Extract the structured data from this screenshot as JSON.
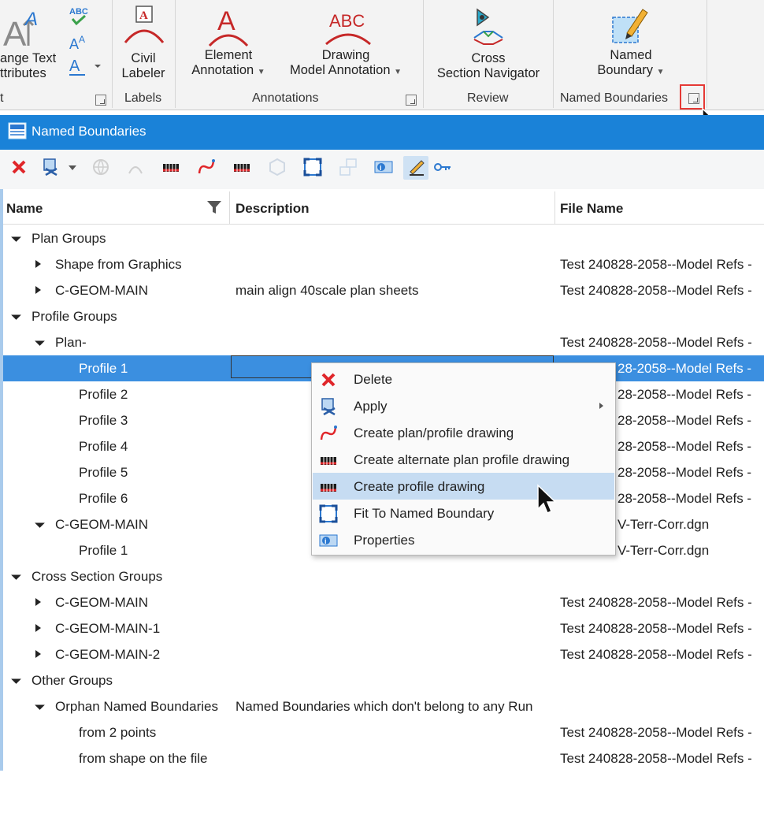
{
  "ribbon": {
    "text_group": {
      "button_label_line1": "ange Text",
      "button_label_line2": "ttributes",
      "group_label": "t"
    },
    "labels_group": {
      "button_label_line1": "Civil",
      "button_label_line2": "Labeler",
      "group_label": "Labels"
    },
    "annotations_group": {
      "element_line1": "Element",
      "element_line2": "Annotation",
      "drawing_line1": "Drawing",
      "drawing_line2": "Model Annotation",
      "group_label": "Annotations"
    },
    "review_group": {
      "button_label_line1": "Cross",
      "button_label_line2": "Section Navigator",
      "group_label": "Review"
    },
    "named_boundaries_group": {
      "button_label_line1": "Named",
      "button_label_line2": "Boundary",
      "group_label": "Named Boundaries"
    },
    "icon_texts": {
      "abc_small": "ABC",
      "abc_large": "ABC",
      "letter_a": "A"
    }
  },
  "window": {
    "title": "Named Boundaries"
  },
  "grid": {
    "columns": {
      "name": "Name",
      "description": "Description",
      "file_name": "File Name"
    },
    "rows": [
      {
        "name": "Plan Groups",
        "description": "",
        "file": ""
      },
      {
        "name": "Shape from Graphics",
        "description": "",
        "file": "Test 240828-2058--Model Refs -"
      },
      {
        "name": "C-GEOM-MAIN",
        "description": "main align 40scale plan sheets",
        "file": "Test 240828-2058--Model Refs -"
      },
      {
        "name": "Profile Groups",
        "description": "",
        "file": ""
      },
      {
        "name": "Plan-",
        "description": "",
        "file": "Test 240828-2058--Model Refs -"
      },
      {
        "name": "Profile 1",
        "description": "",
        "file": "28-2058--Model Refs -"
      },
      {
        "name": "Profile 2",
        "description": "",
        "file": "28-2058--Model Refs -"
      },
      {
        "name": "Profile 3",
        "description": "",
        "file": "28-2058--Model Refs -"
      },
      {
        "name": "Profile 4",
        "description": "",
        "file": "28-2058--Model Refs -"
      },
      {
        "name": "Profile 5",
        "description": "",
        "file": "28-2058--Model Refs -"
      },
      {
        "name": "Profile 6",
        "description": "",
        "file": "28-2058--Model Refs -"
      },
      {
        "name": "C-GEOM-MAIN",
        "description": "",
        "file": "V-Terr-Corr.dgn"
      },
      {
        "name": "Profile 1",
        "description": "",
        "file": "V-Terr-Corr.dgn"
      },
      {
        "name": "Cross Section Groups",
        "description": "",
        "file": ""
      },
      {
        "name": "C-GEOM-MAIN",
        "description": "",
        "file": "Test 240828-2058--Model Refs -"
      },
      {
        "name": "C-GEOM-MAIN-1",
        "description": "",
        "file": "Test 240828-2058--Model Refs -"
      },
      {
        "name": "C-GEOM-MAIN-2",
        "description": "",
        "file": "Test 240828-2058--Model Refs -"
      },
      {
        "name": "Other Groups",
        "description": "",
        "file": ""
      },
      {
        "name": "Orphan Named Boundaries",
        "description": "Named Boundaries which don't belong to any Run",
        "file": ""
      },
      {
        "name": "from 2 points",
        "description": "",
        "file": "Test 240828-2058--Model Refs -"
      },
      {
        "name": "from shape on the file",
        "description": "",
        "file": "Test 240828-2058--Model Refs -"
      }
    ]
  },
  "context_menu": {
    "items": [
      {
        "label": "Delete"
      },
      {
        "label": "Apply"
      },
      {
        "label": "Create plan/profile drawing"
      },
      {
        "label": "Create alternate plan profile drawing"
      },
      {
        "label": "Create profile drawing"
      },
      {
        "label": "Fit To Named Boundary"
      },
      {
        "label": "Properties"
      }
    ]
  },
  "colors": {
    "title_bar": "#1a82d8",
    "selection": "#3b8fe0",
    "menu_highlight": "#c6dcf2",
    "highlight_box": "#e53935"
  }
}
